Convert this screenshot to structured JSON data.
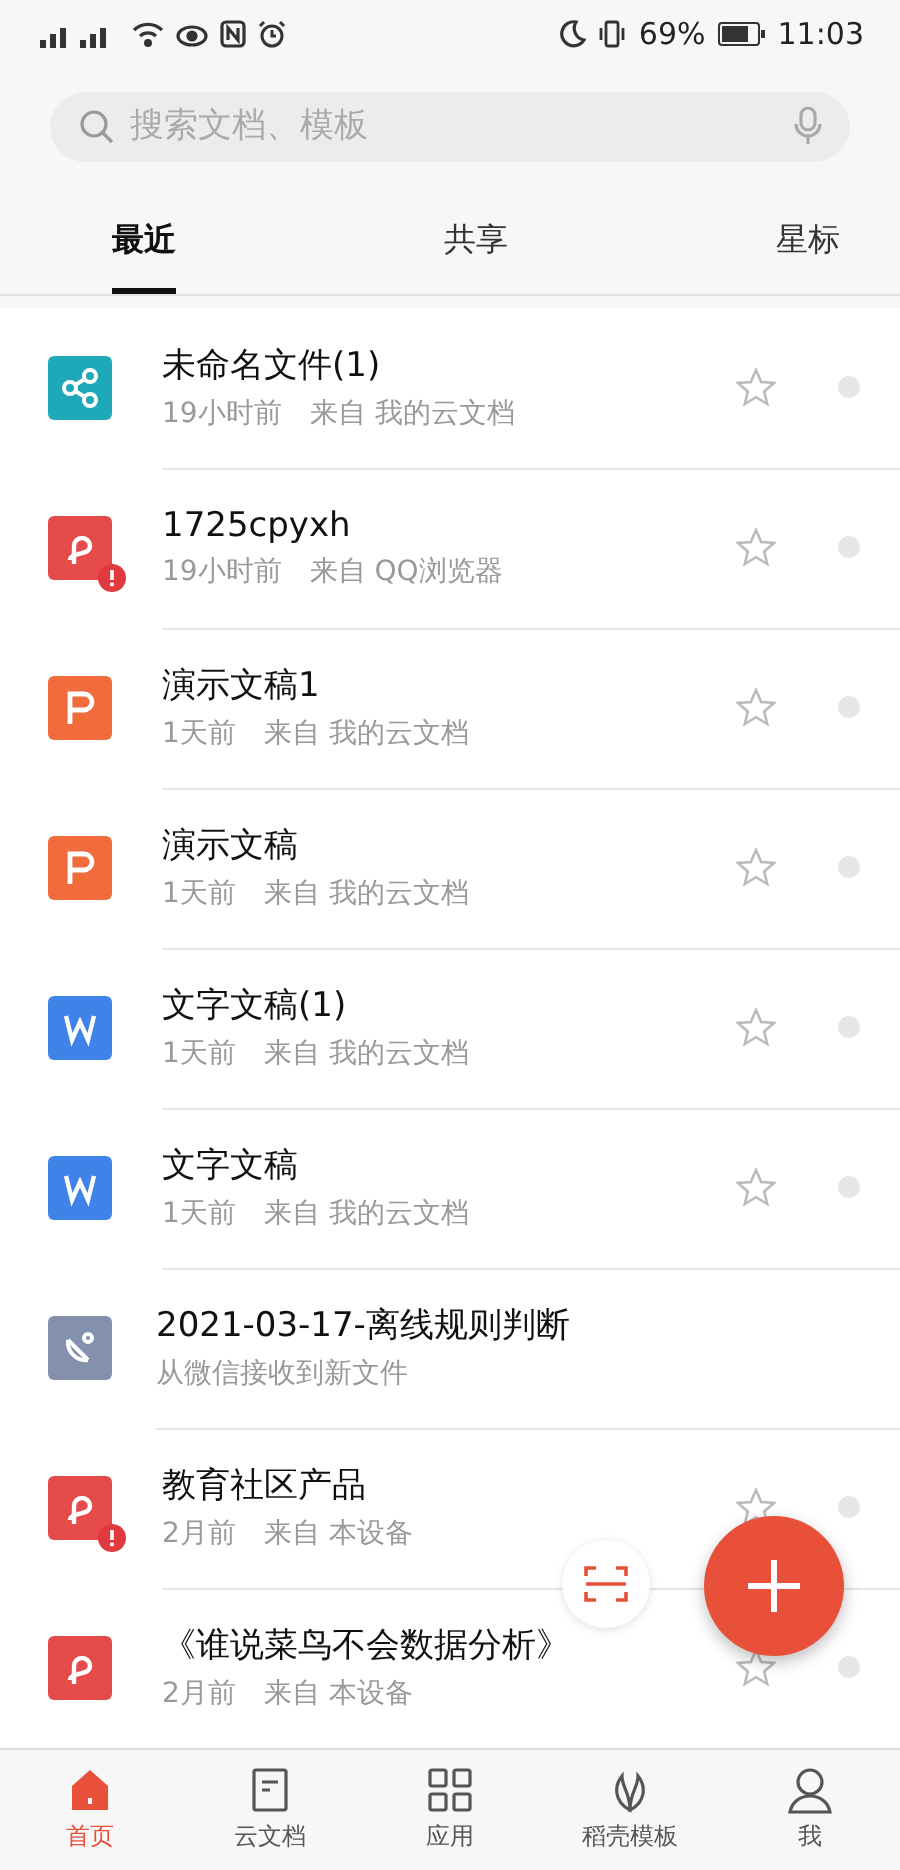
{
  "status_bar": {
    "battery": "69%",
    "time": "11:03"
  },
  "search": {
    "placeholder": "搜索文档、模板"
  },
  "tabs": [
    {
      "label": "最近",
      "selected": true
    },
    {
      "label": "共享",
      "selected": false
    },
    {
      "label": "星标",
      "selected": false
    }
  ],
  "files": [
    {
      "kind": "share",
      "name": "未命名文件(1)",
      "time": "19小时前",
      "source": "来自 我的云文档",
      "alert": false,
      "starred": false
    },
    {
      "kind": "pdf",
      "name": "1725cpyxh",
      "time": "19小时前",
      "source": "来自 QQ浏览器",
      "alert": true,
      "starred": false
    },
    {
      "kind": "ppt",
      "name": "演示文稿1",
      "time": "1天前",
      "source": "来自 我的云文档",
      "alert": false,
      "starred": false
    },
    {
      "kind": "ppt",
      "name": "演示文稿",
      "time": "1天前",
      "source": "来自 我的云文档",
      "alert": false,
      "starred": false
    },
    {
      "kind": "word",
      "name": "文字文稿(1)",
      "time": "1天前",
      "source": "来自 我的云文档",
      "alert": false,
      "starred": false
    },
    {
      "kind": "word",
      "name": "文字文稿",
      "time": "1天前",
      "source": "来自 我的云文档",
      "alert": false,
      "starred": false
    },
    {
      "kind": "wechat",
      "name": "2021-03-17-离线规则判断",
      "source": "从微信接收到新文件",
      "alert": false
    },
    {
      "kind": "pdf",
      "name": "教育社区产品",
      "time": "2月前",
      "source": "来自 本设备",
      "alert": true,
      "starred": false
    },
    {
      "kind": "pdf",
      "name": "《谁说菜鸟不会数据分析》",
      "time": "2月前",
      "source": "来自 本设备",
      "alert": false,
      "starred": false
    }
  ],
  "nav": [
    {
      "kind": "home",
      "label": "首页",
      "selected": true
    },
    {
      "kind": "cloud",
      "label": "云文档",
      "selected": false
    },
    {
      "kind": "apps",
      "label": "应用",
      "selected": false
    },
    {
      "kind": "templates",
      "label": "稻壳模板",
      "selected": false
    },
    {
      "kind": "me",
      "label": "我",
      "selected": false
    }
  ]
}
